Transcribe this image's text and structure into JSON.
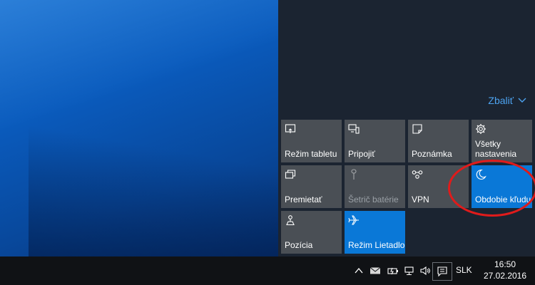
{
  "action_center": {
    "collapse_label": "Zbaliť",
    "tiles": [
      {
        "label": "Režim tabletu",
        "icon": "tablet-mode-icon",
        "state": "off"
      },
      {
        "label": "Pripojiť",
        "icon": "connect-icon",
        "state": "off"
      },
      {
        "label": "Poznámka",
        "icon": "note-icon",
        "state": "off"
      },
      {
        "label": "Všetky nastavenia",
        "icon": "gear-icon",
        "state": "off"
      },
      {
        "label": "Premietať",
        "icon": "project-icon",
        "state": "off"
      },
      {
        "label": "Šetrič batérie",
        "icon": "battery-saver-icon",
        "state": "disabled"
      },
      {
        "label": "VPN",
        "icon": "vpn-icon",
        "state": "off"
      },
      {
        "label": "Obdobie kľudu",
        "icon": "moon-icon",
        "state": "on"
      },
      {
        "label": "Pozícia",
        "icon": "location-icon",
        "state": "off"
      },
      {
        "label": "Režim Lietadlo",
        "icon": "airplane-icon",
        "state": "on"
      }
    ]
  },
  "taskbar": {
    "language": "SLK",
    "time": "16:50",
    "date": "27.02.2016",
    "tray_icons": [
      "chevron-up-icon",
      "mail-icon",
      "battery-icon",
      "network-icon",
      "volume-icon",
      "notification-icon"
    ]
  },
  "colors": {
    "accent": "#0a78d7",
    "tile_off": "#4a4f55",
    "panel": "#1b2431",
    "annotation": "#e01b1b"
  }
}
